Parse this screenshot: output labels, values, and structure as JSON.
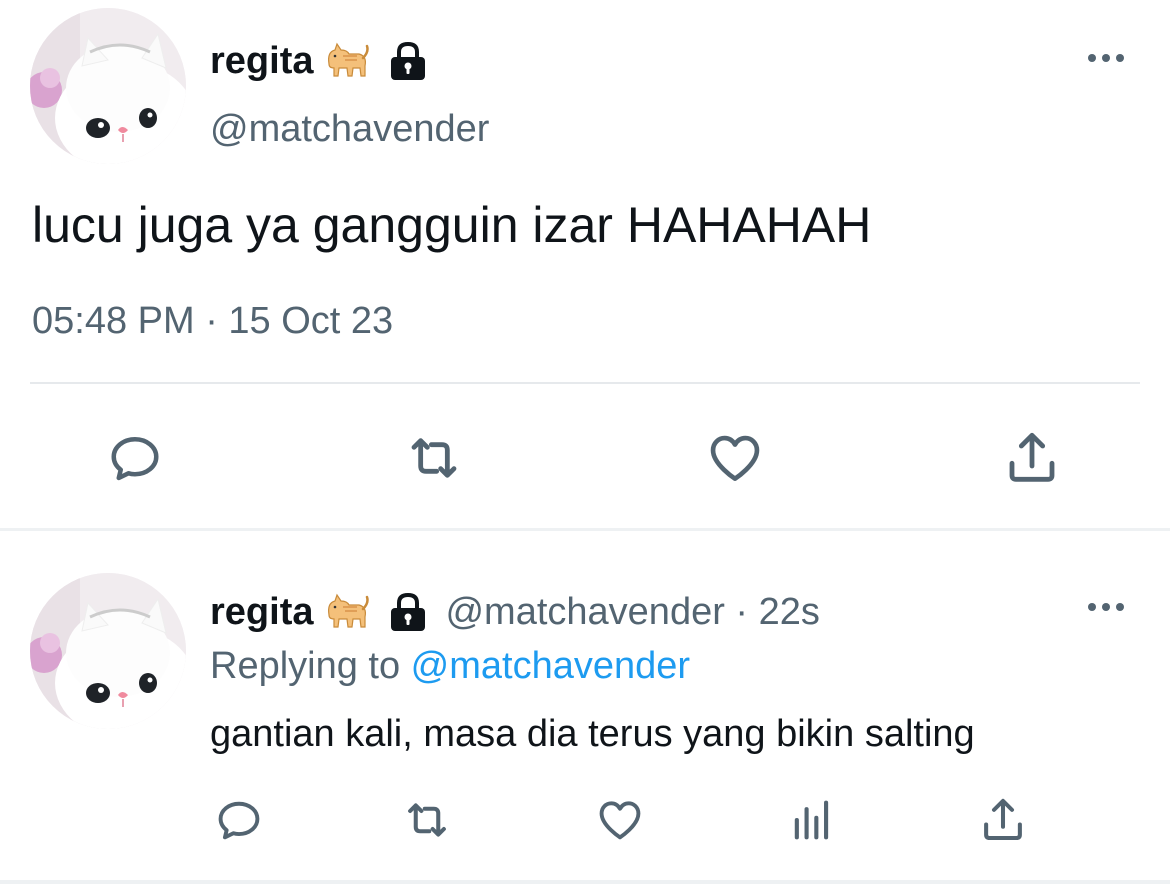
{
  "colors": {
    "text_primary": "#0f1419",
    "text_secondary": "#536471",
    "link": "#1d9bf0",
    "divider": "#e6e9ec"
  },
  "icons": {
    "avatar": "white-cat-avatar",
    "name_emoji": "cat-emoji",
    "protected": "lock-icon",
    "more": "more-dots-icon",
    "actions": [
      "reply-icon",
      "retweet-icon",
      "like-icon",
      "analytics-icon",
      "share-icon"
    ]
  },
  "main_tweet": {
    "display_name": "regita",
    "handle": "@matchavender",
    "text": "lucu juga ya gangguin izar HAHAHAH",
    "timestamp": "05:48 PM · 15 Oct 23"
  },
  "reply_tweet": {
    "display_name": "regita",
    "handle_time": "@matchavender · 22s",
    "replying_prefix": "Replying to ",
    "replying_to": "@matchavender",
    "text": "gantian kali, masa dia terus yang bikin salting"
  }
}
